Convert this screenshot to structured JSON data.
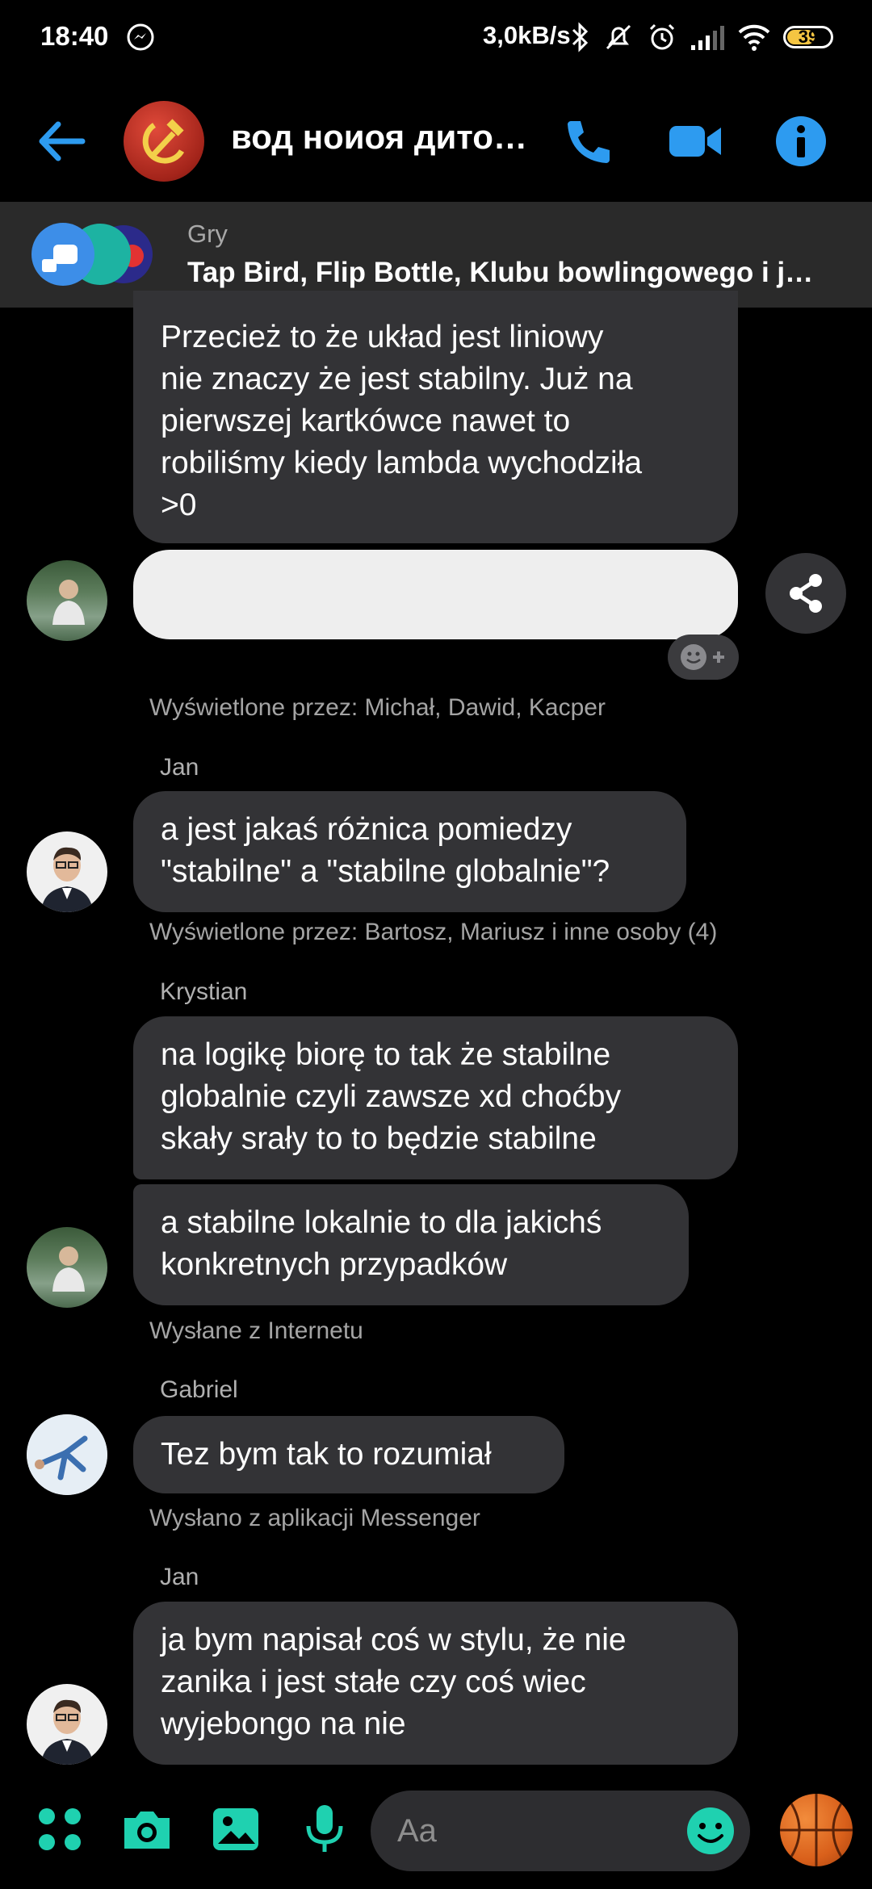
{
  "status_bar": {
    "time": "18:40",
    "network_speed": "3,0kB/s",
    "battery": "39"
  },
  "header": {
    "chat_title": "вод ноиоя дито…",
    "icons": [
      "back-arrow-icon",
      "phone-icon",
      "video-camera-icon",
      "info-icon"
    ],
    "accent_color": "#2d9bf0"
  },
  "games_banner": {
    "label": "Gry",
    "games_text": "Tap Bird, Flip Bottle, Klubu bowlingowego i j…"
  },
  "messages": {
    "m1_text": "Przecież to że układ jest liniowy\nnie znaczy że jest stabilny. Już na\npierwszej kartkówce nawet to\nrobiliśmy kiedy lambda wychodziła\n>0",
    "m1_receipt": "Wyświetlone przez: Michał, Dawid, Kacper",
    "m2_sender": "Jan",
    "m2_text": "a jest jakaś różnica pomiedzy\n\"stabilne\" a \"stabilne globalnie\"?",
    "m2_receipt": "Wyświetlone przez: Bartosz, Mariusz i inne osoby (4)",
    "m3_sender": "Krystian",
    "m3_text": "na logikę biorę to tak że stabilne\nglobalnie czyli zawsze xd choćby\nskały srały to to będzie stabilne",
    "m4_text": "a stabilne lokalnie to dla jakichś\nkonkretnych przypadków",
    "m4_receipt": "Wysłane z Internetu",
    "m5_sender": "Gabriel",
    "m5_text": "Tez bym tak to rozumiał",
    "m5_receipt": "Wysłano z aplikacji Messenger",
    "m6_sender": "Jan",
    "m6_text": "ja bym napisał coś w stylu, że nie\nzanika i jest stałe czy coś wiec\nwyjebongo na nie"
  },
  "composer": {
    "placeholder": "Aa",
    "accent_color": "#1fd1b0",
    "icons": [
      "apps-grid-icon",
      "camera-icon",
      "gallery-icon",
      "microphone-icon",
      "emoji-icon",
      "basketball-icon"
    ]
  }
}
